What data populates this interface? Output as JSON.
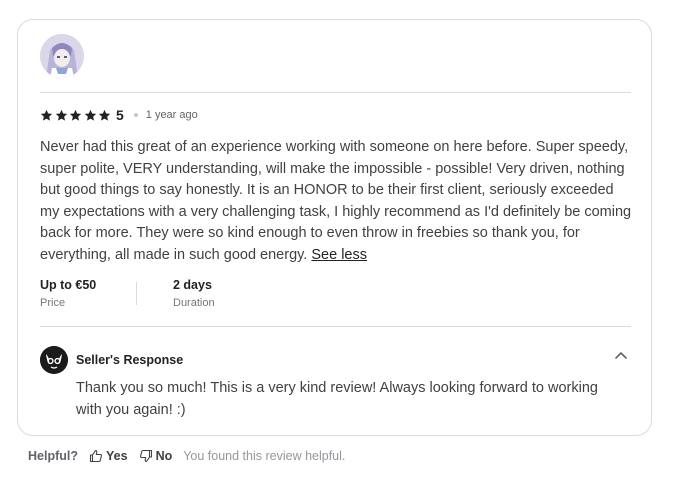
{
  "review": {
    "rating_value": "5",
    "stars_filled": 5,
    "time_ago": "1 year ago",
    "text": "Never had this great of an experience working with someone on here before. Super speedy, super polite, VERY understanding, will make the impossible - possible! Very driven, nothing but good things to say honestly. It is an HONOR to be their first client, seriously exceeded my expectations with a very challenging task, I highly recommend as I'd definitely be coming back for more. They were so kind enough to even throw in freebies so thank you, for everything, all made in such good energy.",
    "see_less_label": "See less",
    "price_value": "Up to €50",
    "price_label": "Price",
    "duration_value": "2 days",
    "duration_label": "Duration"
  },
  "seller_response": {
    "title": "Seller's Response",
    "text": "Thank you so much! This is a very kind review! Always looking forward to working with you again! :)"
  },
  "helpful": {
    "label": "Helpful?",
    "yes_label": "Yes",
    "no_label": "No",
    "status": "You found this review helpful."
  },
  "colors": {
    "star": "#222325",
    "border": "#dadbdd",
    "text": "#404145"
  },
  "icons": [
    "avatar-image",
    "star-icon",
    "chevron-up-icon",
    "thumbs-up-icon",
    "thumbs-down-icon",
    "seller-logo"
  ]
}
